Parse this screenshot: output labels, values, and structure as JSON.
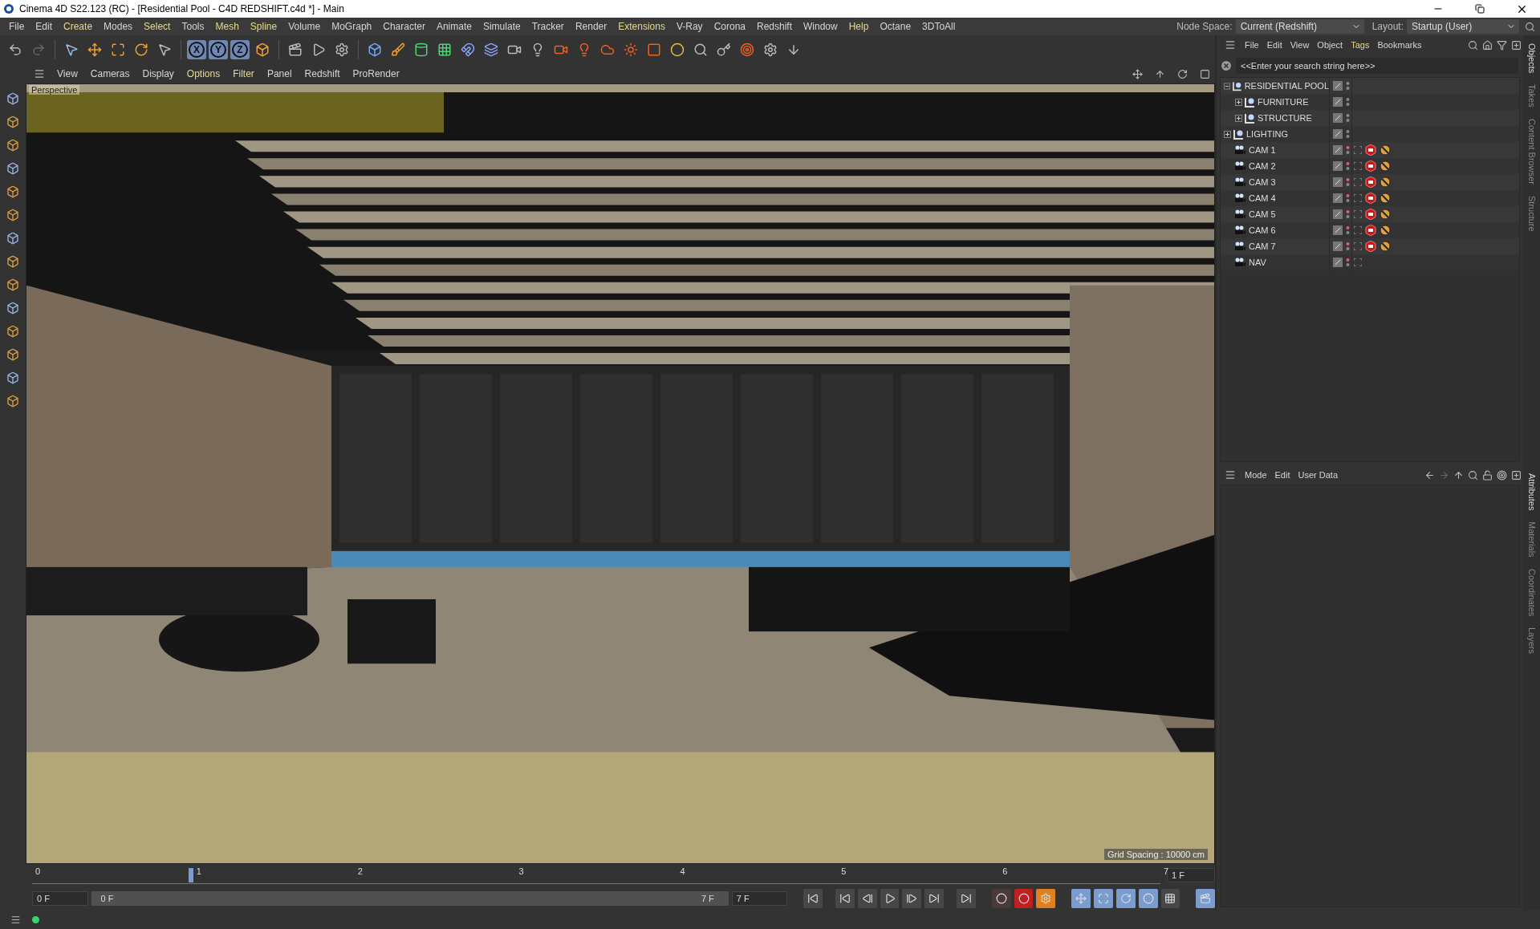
{
  "window": {
    "title": "Cinema 4D S22.123 (RC) - [Residential Pool - C4D REDSHIFT.c4d *] - Main"
  },
  "menu": [
    {
      "label": "File",
      "accent": false
    },
    {
      "label": "Edit",
      "accent": false
    },
    {
      "label": "Create",
      "accent": true
    },
    {
      "label": "Modes",
      "accent": false
    },
    {
      "label": "Select",
      "accent": true
    },
    {
      "label": "Tools",
      "accent": false
    },
    {
      "label": "Mesh",
      "accent": true
    },
    {
      "label": "Spline",
      "accent": true
    },
    {
      "label": "Volume",
      "accent": false
    },
    {
      "label": "MoGraph",
      "accent": false
    },
    {
      "label": "Character",
      "accent": false
    },
    {
      "label": "Animate",
      "accent": false
    },
    {
      "label": "Simulate",
      "accent": false
    },
    {
      "label": "Tracker",
      "accent": false
    },
    {
      "label": "Render",
      "accent": false
    },
    {
      "label": "Extensions",
      "accent": true
    },
    {
      "label": "V-Ray",
      "accent": false
    },
    {
      "label": "Corona",
      "accent": false
    },
    {
      "label": "Redshift",
      "accent": false
    },
    {
      "label": "Window",
      "accent": false
    },
    {
      "label": "Help",
      "accent": true
    },
    {
      "label": "Octane",
      "accent": false
    },
    {
      "label": "3DToAll",
      "accent": false
    }
  ],
  "node_space": {
    "label": "Node Space:",
    "value": "Current (Redshift)"
  },
  "layout": {
    "label": "Layout:",
    "value": "Startup (User)"
  },
  "toolbar": {
    "axis_buttons": [
      "X",
      "Y",
      "Z"
    ]
  },
  "viewport": {
    "menu": [
      {
        "label": "View",
        "accent": false
      },
      {
        "label": "Cameras",
        "accent": false
      },
      {
        "label": "Display",
        "accent": false
      },
      {
        "label": "Options",
        "accent": true
      },
      {
        "label": "Filter",
        "accent": true
      },
      {
        "label": "Panel",
        "accent": false
      },
      {
        "label": "Redshift",
        "accent": false
      },
      {
        "label": "ProRender",
        "accent": false
      }
    ],
    "view_name": "Perspective",
    "grid_spacing": "Grid Spacing : 10000 cm"
  },
  "object_manager": {
    "menu": [
      {
        "label": "File",
        "accent": false
      },
      {
        "label": "Edit",
        "accent": false
      },
      {
        "label": "View",
        "accent": false
      },
      {
        "label": "Object",
        "accent": false
      },
      {
        "label": "Tags",
        "accent": true
      },
      {
        "label": "Bookmarks",
        "accent": false
      }
    ],
    "search": {
      "placeholder": "<<Enter your search string here>>"
    },
    "objects": [
      {
        "name": "RESIDENTIAL POOL",
        "kind": "null",
        "expanded": true,
        "children": [
          {
            "name": "FURNITURE",
            "kind": "null",
            "expanded": false
          },
          {
            "name": "STRUCTURE",
            "kind": "null",
            "expanded": false
          }
        ]
      },
      {
        "name": "LIGHTING",
        "kind": "null",
        "expanded": false
      },
      {
        "name": "CAM 1",
        "kind": "camera",
        "tagged": true
      },
      {
        "name": "CAM 2",
        "kind": "camera",
        "tagged": true
      },
      {
        "name": "CAM 3",
        "kind": "camera",
        "tagged": true
      },
      {
        "name": "CAM 4",
        "kind": "camera",
        "tagged": true
      },
      {
        "name": "CAM 5",
        "kind": "camera",
        "tagged": true
      },
      {
        "name": "CAM 6",
        "kind": "camera",
        "tagged": true
      },
      {
        "name": "CAM 7",
        "kind": "camera",
        "tagged": true
      },
      {
        "name": "NAV",
        "kind": "camera",
        "tagged": false
      }
    ]
  },
  "attribute_manager": {
    "menu": [
      {
        "label": "Mode",
        "accent": false
      },
      {
        "label": "Edit",
        "accent": false
      },
      {
        "label": "User Data",
        "accent": false
      }
    ]
  },
  "side_tabs_top": [
    "Objects",
    "Takes",
    "Content Browser",
    "Structure"
  ],
  "side_tabs_bottom": [
    "Attributes",
    "Materials",
    "Coordinates",
    "Layers"
  ],
  "timeline": {
    "ticks": [
      "0",
      "1",
      "2",
      "3",
      "4",
      "5",
      "6",
      "7"
    ],
    "level": 0.143,
    "frame_field": "1 F"
  },
  "playback": {
    "start_field": "0 F",
    "range_start": "0 F",
    "range_end": "7 F",
    "end_field": "7 F"
  }
}
